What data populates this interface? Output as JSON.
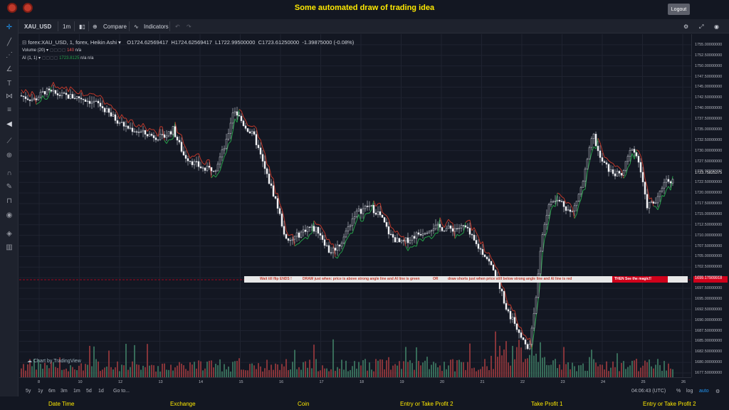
{
  "header": {
    "title": "Some automated draw of trading idea",
    "logout": "Logout"
  },
  "toolbar": {
    "symbol": "XAU_USD",
    "interval": "1m",
    "compare": "Compare",
    "indicators": "Indicators"
  },
  "legend": {
    "symbol_line": "forex:XAU_USD, 1, forex, Heikin Ashi",
    "open": "O1724.62569417",
    "high": "H1724.62569417",
    "low": "L1722.99500000",
    "close": "C1723.61250000",
    "change": "-1.39875000 (-0.08%)",
    "volume_label": "Volume (20)",
    "volume_value": "140",
    "volume_na": "n/a",
    "ai_label": "AI (1, 1)",
    "ai_value": "1723.8125",
    "ai_na1": "n/a",
    "ai_na2": "n/a"
  },
  "price_axis": {
    "ticks": [
      "1755.00000000",
      "1752.50000000",
      "1750.00000000",
      "1747.50000000",
      "1745.00000000",
      "1742.50000000",
      "1740.00000000",
      "1737.50000000",
      "1735.00000000",
      "1732.50000000",
      "1730.00000000",
      "1727.50000000",
      "1725.00000000",
      "1722.50000000",
      "1720.00000000",
      "1717.50000000",
      "1715.00000000",
      "1712.50000000",
      "1710.00000000",
      "1707.50000000",
      "1705.00000000",
      "1702.50000000",
      "1700.00000000",
      "1697.50000000",
      "1695.00000000",
      "1692.50000000",
      "1690.00000000",
      "1687.50000000",
      "1685.00000000",
      "1682.50000000",
      "1680.00000000",
      "1677.50000000"
    ],
    "current_price": "1723.75825375",
    "alert_price": "1699.17909918"
  },
  "time_axis": {
    "labels": [
      "8",
      "10",
      "12",
      "13",
      "14",
      "15",
      "16",
      "17",
      "18",
      "19",
      "20",
      "21",
      "22",
      "23",
      "24",
      "25",
      "26"
    ]
  },
  "banner": {
    "part1": "Wait till flip ENDS  !",
    "part2": "DRAW just when:  price is above strong angle line and AI line is green",
    "part3": "OR",
    "part4": "draw shorts just when price still below strong angle line and AI line is red",
    "magic": "THEN See the magic!!"
  },
  "watermark": "Chart by TradingView",
  "bottom_bar": {
    "ranges": [
      "5y",
      "1y",
      "6m",
      "3m",
      "1m",
      "5d",
      "1d"
    ],
    "goto": "Go to...",
    "clock": "04:06:43 (UTC)",
    "percent": "%",
    "log": "log",
    "auto": "auto"
  },
  "footer": {
    "items": [
      "Date Time",
      "Exchange",
      "Coin",
      "Entry or Take Profit 2",
      "Take Profit 1",
      "Entry or Take Profit 2"
    ]
  },
  "colors": {
    "up": "#d1d4dc",
    "down": "#ffffff",
    "ai_green": "#26a14a",
    "ai_red": "#c0392b",
    "vol_up": "#3e7a63",
    "vol_down": "#9a3a3d",
    "title": "#ffea00"
  },
  "chart_data": {
    "type": "candlestick",
    "y_range": [
      1676.5,
      1757.5
    ],
    "price_path_keypoints": [
      [
        0,
        1743.0
      ],
      [
        20,
        1742.0
      ],
      [
        35,
        1744.0
      ],
      [
        60,
        1743.0
      ],
      [
        85,
        1742.5
      ],
      [
        110,
        1741.0
      ],
      [
        130,
        1738.0
      ],
      [
        150,
        1735.5
      ],
      [
        175,
        1734.0
      ],
      [
        200,
        1733.0
      ],
      [
        215,
        1735.0
      ],
      [
        230,
        1729.0
      ],
      [
        245,
        1727.0
      ],
      [
        260,
        1725.5
      ],
      [
        275,
        1726.0
      ],
      [
        290,
        1732.0
      ],
      [
        300,
        1740.0
      ],
      [
        315,
        1736.0
      ],
      [
        330,
        1733.0
      ],
      [
        345,
        1725.0
      ],
      [
        360,
        1718.0
      ],
      [
        375,
        1708.0
      ],
      [
        390,
        1710.0
      ],
      [
        405,
        1712.0
      ],
      [
        420,
        1711.0
      ],
      [
        435,
        1706.0
      ],
      [
        450,
        1708.0
      ],
      [
        470,
        1715.0
      ],
      [
        490,
        1717.0
      ],
      [
        505,
        1715.0
      ],
      [
        520,
        1710.0
      ],
      [
        535,
        1708.0
      ],
      [
        555,
        1710.0
      ],
      [
        580,
        1712.0
      ],
      [
        605,
        1711.5
      ],
      [
        625,
        1712.0
      ],
      [
        640,
        1708.0
      ],
      [
        655,
        1705.0
      ],
      [
        670,
        1700.0
      ],
      [
        685,
        1692.0
      ],
      [
        700,
        1688.0
      ],
      [
        715,
        1683.0
      ],
      [
        725,
        1696.0
      ],
      [
        735,
        1712.0
      ],
      [
        745,
        1718.0
      ],
      [
        760,
        1718.0
      ],
      [
        775,
        1715.0
      ],
      [
        790,
        1722.0
      ],
      [
        805,
        1734.0
      ],
      [
        815,
        1728.0
      ],
      [
        830,
        1725.0
      ],
      [
        845,
        1724.0
      ],
      [
        860,
        1731.0
      ],
      [
        870,
        1727.0
      ],
      [
        880,
        1717.0
      ],
      [
        895,
        1718.0
      ],
      [
        905,
        1723.0
      ],
      [
        918,
        1723.0
      ]
    ],
    "volume_max": 1.0
  }
}
